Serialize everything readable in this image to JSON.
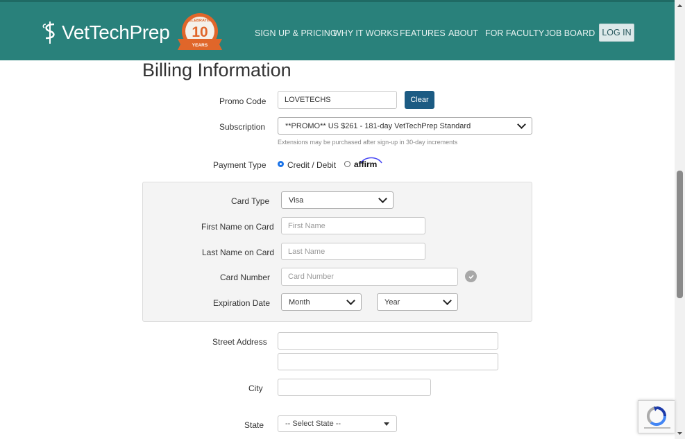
{
  "header": {
    "brand_text": "VetTechPrep",
    "badge_top": "CELEBRATING",
    "badge_number": "10",
    "badge_bottom": "YEARS",
    "nav": [
      "SIGN UP & PRICING",
      "WHY IT WORKS",
      "FEATURES",
      "ABOUT",
      "FOR FACULTY",
      "JOB BOARD"
    ],
    "login_label": "LOG IN"
  },
  "billing": {
    "title": "Billing Information",
    "promo_label": "Promo Code",
    "promo_value": "LOVETECHS",
    "clear_label": "Clear",
    "subscription_label": "Subscription",
    "subscription_value": "**PROMO** US $261 - 181-day VetTechPrep Standard",
    "subscription_hint": "Extensions may be purchased after sign-up in 30-day increments",
    "payment_type_label": "Payment Type",
    "payment_options": [
      "Credit / Debit",
      "affirm"
    ],
    "payment_selected": "Credit / Debit"
  },
  "card": {
    "card_type_label": "Card Type",
    "card_type_value": "Visa",
    "first_name_label": "First Name on Card",
    "first_name_placeholder": "First Name",
    "last_name_label": "Last Name on Card",
    "last_name_placeholder": "Last Name",
    "card_number_label": "Card Number",
    "card_number_placeholder": "Card Number",
    "expiration_label": "Expiration Date",
    "month_value": "Month",
    "year_value": "Year"
  },
  "address": {
    "street_label": "Street Address",
    "street_line1": "",
    "street_line2": "",
    "city_label": "City",
    "city_value": "",
    "state_label": "State",
    "state_value": "-- Select State --"
  },
  "colors": {
    "header_bg": "#29817b",
    "clear_button": "#1c5b83",
    "radio_selected": "#1a73e8",
    "badge_orange": "#e0662a"
  },
  "icons": [
    "caduceus-logo-icon",
    "anniversary-badge-icon",
    "chevron-down-icon",
    "check-circle-icon",
    "recaptcha-icon"
  ]
}
